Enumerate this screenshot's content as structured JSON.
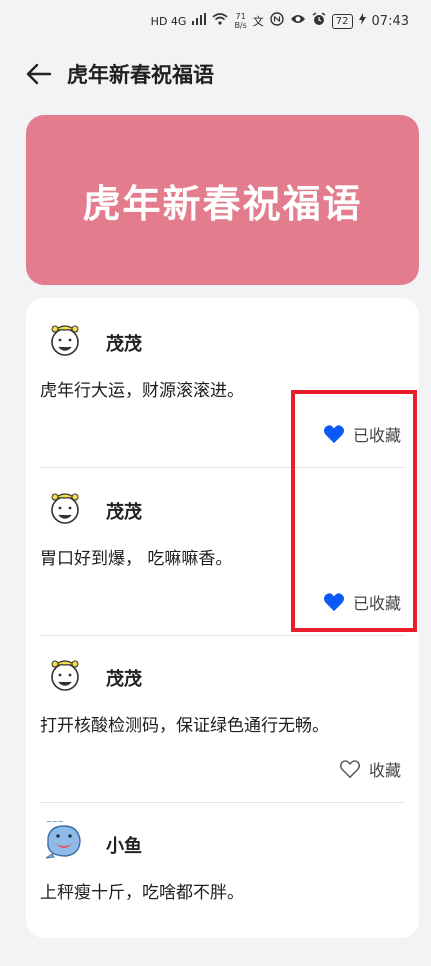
{
  "status_bar": {
    "net": "HD 4G",
    "speed_value": "71",
    "speed_unit": "B/s",
    "extra": "文",
    "battery": "72",
    "time": "07:43"
  },
  "header": {
    "title": "虎年新春祝福语"
  },
  "banner": {
    "text": "虎年新春祝福语"
  },
  "items": [
    {
      "author": "茂茂",
      "content": "虎年行大运，财源滚滚进。",
      "fav_label": "已收藏",
      "favorited": true
    },
    {
      "author": "茂茂",
      "content": "胃口好到爆， 吃嘛嘛香。",
      "fav_label": "已收藏",
      "favorited": true
    },
    {
      "author": "茂茂",
      "content": "打开核酸检测码，保证绿色通行无畅。",
      "fav_label": "收藏",
      "favorited": false
    },
    {
      "author": "小鱼",
      "content": "上秤瘦十斤，吃啥都不胖。",
      "fav_label": "",
      "favorited": false
    }
  ],
  "colors": {
    "banner": "#e37d8e",
    "heart_active": "#0a59f7",
    "highlight": "#ea1d2c"
  }
}
